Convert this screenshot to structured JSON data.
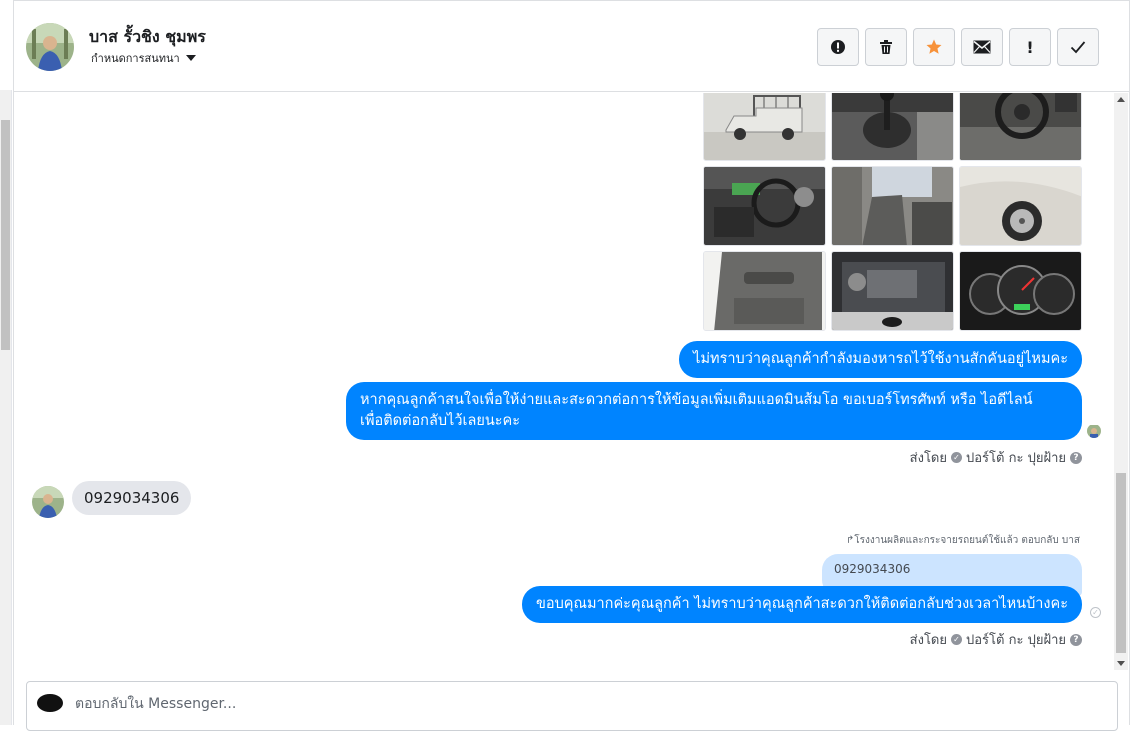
{
  "header": {
    "contact_name": "บาส รั้วชิง ชุมพร",
    "assign_label": "กำหนดการสนทนา"
  },
  "actions": [
    {
      "name": "spam-report-button",
      "icon": "alert-circle-icon",
      "glyph": "❗"
    },
    {
      "name": "delete-button",
      "icon": "trash-icon",
      "glyph": "🗑"
    },
    {
      "name": "star-button",
      "icon": "star-icon",
      "glyph": "★"
    },
    {
      "name": "mark-unread-button",
      "icon": "envelope-icon",
      "glyph": "✉"
    },
    {
      "name": "follow-up-button",
      "icon": "exclamation-icon",
      "glyph": "!"
    },
    {
      "name": "mark-done-button",
      "icon": "checkmark-icon",
      "glyph": "✓"
    }
  ],
  "messages": {
    "out_1": "ไม่ทราบว่าคุณลูกค้ากำลังมองหารถไว้ใช้งานสักคันอยู่ไหมคะ",
    "out_2_line1": "หากคุณลูกค้าสนใจเพื่อให้ง่ายและสะดวกต่อการให้ข้อมูลเพิ่มเติมแอดมินส้มโอ ขอเบอร์โทรศัพท์ หรือ ไอดีไลน์",
    "out_2_line2": "เพื่อติดต่อกลับไว้เลยนะคะ",
    "sent_by_1": "ส่งโดย",
    "sent_by_name_1": "ปอร์โต้ กะ ปุยฝ้าย",
    "in_1": "0929034306",
    "reply_note": "↱โรงงานผลิตและกระจายรถยนต์ใช้แล้ว ตอบกลับ บาส",
    "quoted": "0929034306",
    "out_3": "ขอบคุณมากค่ะคุณลูกค้า ไม่ทราบว่าคุณลูกค้าสะดวกให้ติดต่อกลับช่วงเวลาไหนบ้างคะ",
    "sent_by_2": "ส่งโดย",
    "sent_by_name_2": "ปอร์โต้ กะ ปุยฝ้าย"
  },
  "composer": {
    "placeholder": "ตอบกลับใน Messenger..."
  },
  "colors": {
    "bubble_out": "#0084ff",
    "bubble_in": "#e4e6eb",
    "quoted": "#cce4ff",
    "star": "#f7923a"
  }
}
